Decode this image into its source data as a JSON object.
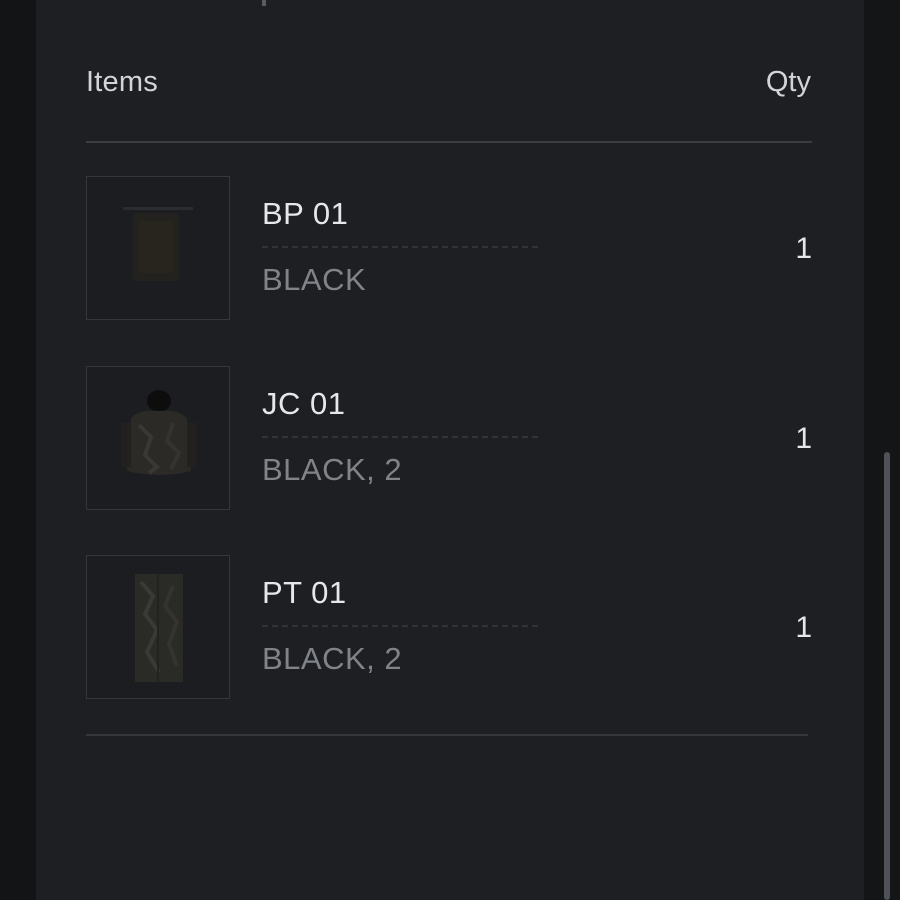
{
  "cart": {
    "header": {
      "items_label": "Items",
      "qty_label": "Qty"
    },
    "items": [
      {
        "name": "BP 01",
        "variant": "BLACK",
        "qty": "1",
        "thumbnail_icon": "product-bp-image"
      },
      {
        "name": "JC 01",
        "variant": "BLACK, 2",
        "qty": "1",
        "thumbnail_icon": "product-jacket-image"
      },
      {
        "name": "PT 01",
        "variant": "BLACK, 2",
        "qty": "1",
        "thumbnail_icon": "product-pants-image"
      }
    ]
  },
  "colors": {
    "panel_background": "#1d1f22",
    "outer_background": "#131416",
    "primary_text": "#e6e7e9",
    "secondary_text": "#808388",
    "divider": "#3a3d41",
    "scrollbar_thumb": "#4e5156"
  }
}
